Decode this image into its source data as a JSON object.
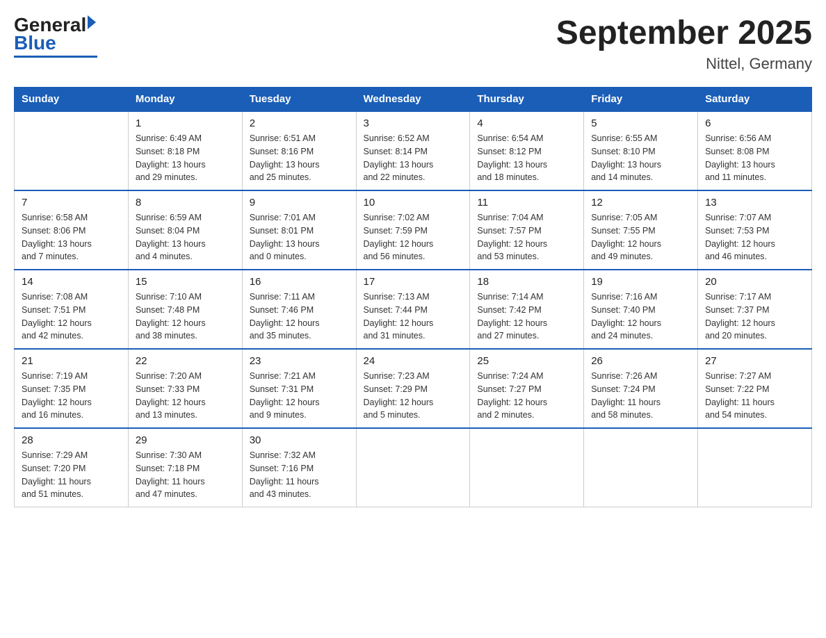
{
  "logo": {
    "general": "General",
    "blue": "Blue"
  },
  "title": "September 2025",
  "subtitle": "Nittel, Germany",
  "weekdays": [
    "Sunday",
    "Monday",
    "Tuesday",
    "Wednesday",
    "Thursday",
    "Friday",
    "Saturday"
  ],
  "weeks": [
    [
      {
        "day": "",
        "info": ""
      },
      {
        "day": "1",
        "info": "Sunrise: 6:49 AM\nSunset: 8:18 PM\nDaylight: 13 hours\nand 29 minutes."
      },
      {
        "day": "2",
        "info": "Sunrise: 6:51 AM\nSunset: 8:16 PM\nDaylight: 13 hours\nand 25 minutes."
      },
      {
        "day": "3",
        "info": "Sunrise: 6:52 AM\nSunset: 8:14 PM\nDaylight: 13 hours\nand 22 minutes."
      },
      {
        "day": "4",
        "info": "Sunrise: 6:54 AM\nSunset: 8:12 PM\nDaylight: 13 hours\nand 18 minutes."
      },
      {
        "day": "5",
        "info": "Sunrise: 6:55 AM\nSunset: 8:10 PM\nDaylight: 13 hours\nand 14 minutes."
      },
      {
        "day": "6",
        "info": "Sunrise: 6:56 AM\nSunset: 8:08 PM\nDaylight: 13 hours\nand 11 minutes."
      }
    ],
    [
      {
        "day": "7",
        "info": "Sunrise: 6:58 AM\nSunset: 8:06 PM\nDaylight: 13 hours\nand 7 minutes."
      },
      {
        "day": "8",
        "info": "Sunrise: 6:59 AM\nSunset: 8:04 PM\nDaylight: 13 hours\nand 4 minutes."
      },
      {
        "day": "9",
        "info": "Sunrise: 7:01 AM\nSunset: 8:01 PM\nDaylight: 13 hours\nand 0 minutes."
      },
      {
        "day": "10",
        "info": "Sunrise: 7:02 AM\nSunset: 7:59 PM\nDaylight: 12 hours\nand 56 minutes."
      },
      {
        "day": "11",
        "info": "Sunrise: 7:04 AM\nSunset: 7:57 PM\nDaylight: 12 hours\nand 53 minutes."
      },
      {
        "day": "12",
        "info": "Sunrise: 7:05 AM\nSunset: 7:55 PM\nDaylight: 12 hours\nand 49 minutes."
      },
      {
        "day": "13",
        "info": "Sunrise: 7:07 AM\nSunset: 7:53 PM\nDaylight: 12 hours\nand 46 minutes."
      }
    ],
    [
      {
        "day": "14",
        "info": "Sunrise: 7:08 AM\nSunset: 7:51 PM\nDaylight: 12 hours\nand 42 minutes."
      },
      {
        "day": "15",
        "info": "Sunrise: 7:10 AM\nSunset: 7:48 PM\nDaylight: 12 hours\nand 38 minutes."
      },
      {
        "day": "16",
        "info": "Sunrise: 7:11 AM\nSunset: 7:46 PM\nDaylight: 12 hours\nand 35 minutes."
      },
      {
        "day": "17",
        "info": "Sunrise: 7:13 AM\nSunset: 7:44 PM\nDaylight: 12 hours\nand 31 minutes."
      },
      {
        "day": "18",
        "info": "Sunrise: 7:14 AM\nSunset: 7:42 PM\nDaylight: 12 hours\nand 27 minutes."
      },
      {
        "day": "19",
        "info": "Sunrise: 7:16 AM\nSunset: 7:40 PM\nDaylight: 12 hours\nand 24 minutes."
      },
      {
        "day": "20",
        "info": "Sunrise: 7:17 AM\nSunset: 7:37 PM\nDaylight: 12 hours\nand 20 minutes."
      }
    ],
    [
      {
        "day": "21",
        "info": "Sunrise: 7:19 AM\nSunset: 7:35 PM\nDaylight: 12 hours\nand 16 minutes."
      },
      {
        "day": "22",
        "info": "Sunrise: 7:20 AM\nSunset: 7:33 PM\nDaylight: 12 hours\nand 13 minutes."
      },
      {
        "day": "23",
        "info": "Sunrise: 7:21 AM\nSunset: 7:31 PM\nDaylight: 12 hours\nand 9 minutes."
      },
      {
        "day": "24",
        "info": "Sunrise: 7:23 AM\nSunset: 7:29 PM\nDaylight: 12 hours\nand 5 minutes."
      },
      {
        "day": "25",
        "info": "Sunrise: 7:24 AM\nSunset: 7:27 PM\nDaylight: 12 hours\nand 2 minutes."
      },
      {
        "day": "26",
        "info": "Sunrise: 7:26 AM\nSunset: 7:24 PM\nDaylight: 11 hours\nand 58 minutes."
      },
      {
        "day": "27",
        "info": "Sunrise: 7:27 AM\nSunset: 7:22 PM\nDaylight: 11 hours\nand 54 minutes."
      }
    ],
    [
      {
        "day": "28",
        "info": "Sunrise: 7:29 AM\nSunset: 7:20 PM\nDaylight: 11 hours\nand 51 minutes."
      },
      {
        "day": "29",
        "info": "Sunrise: 7:30 AM\nSunset: 7:18 PM\nDaylight: 11 hours\nand 47 minutes."
      },
      {
        "day": "30",
        "info": "Sunrise: 7:32 AM\nSunset: 7:16 PM\nDaylight: 11 hours\nand 43 minutes."
      },
      {
        "day": "",
        "info": ""
      },
      {
        "day": "",
        "info": ""
      },
      {
        "day": "",
        "info": ""
      },
      {
        "day": "",
        "info": ""
      }
    ]
  ]
}
